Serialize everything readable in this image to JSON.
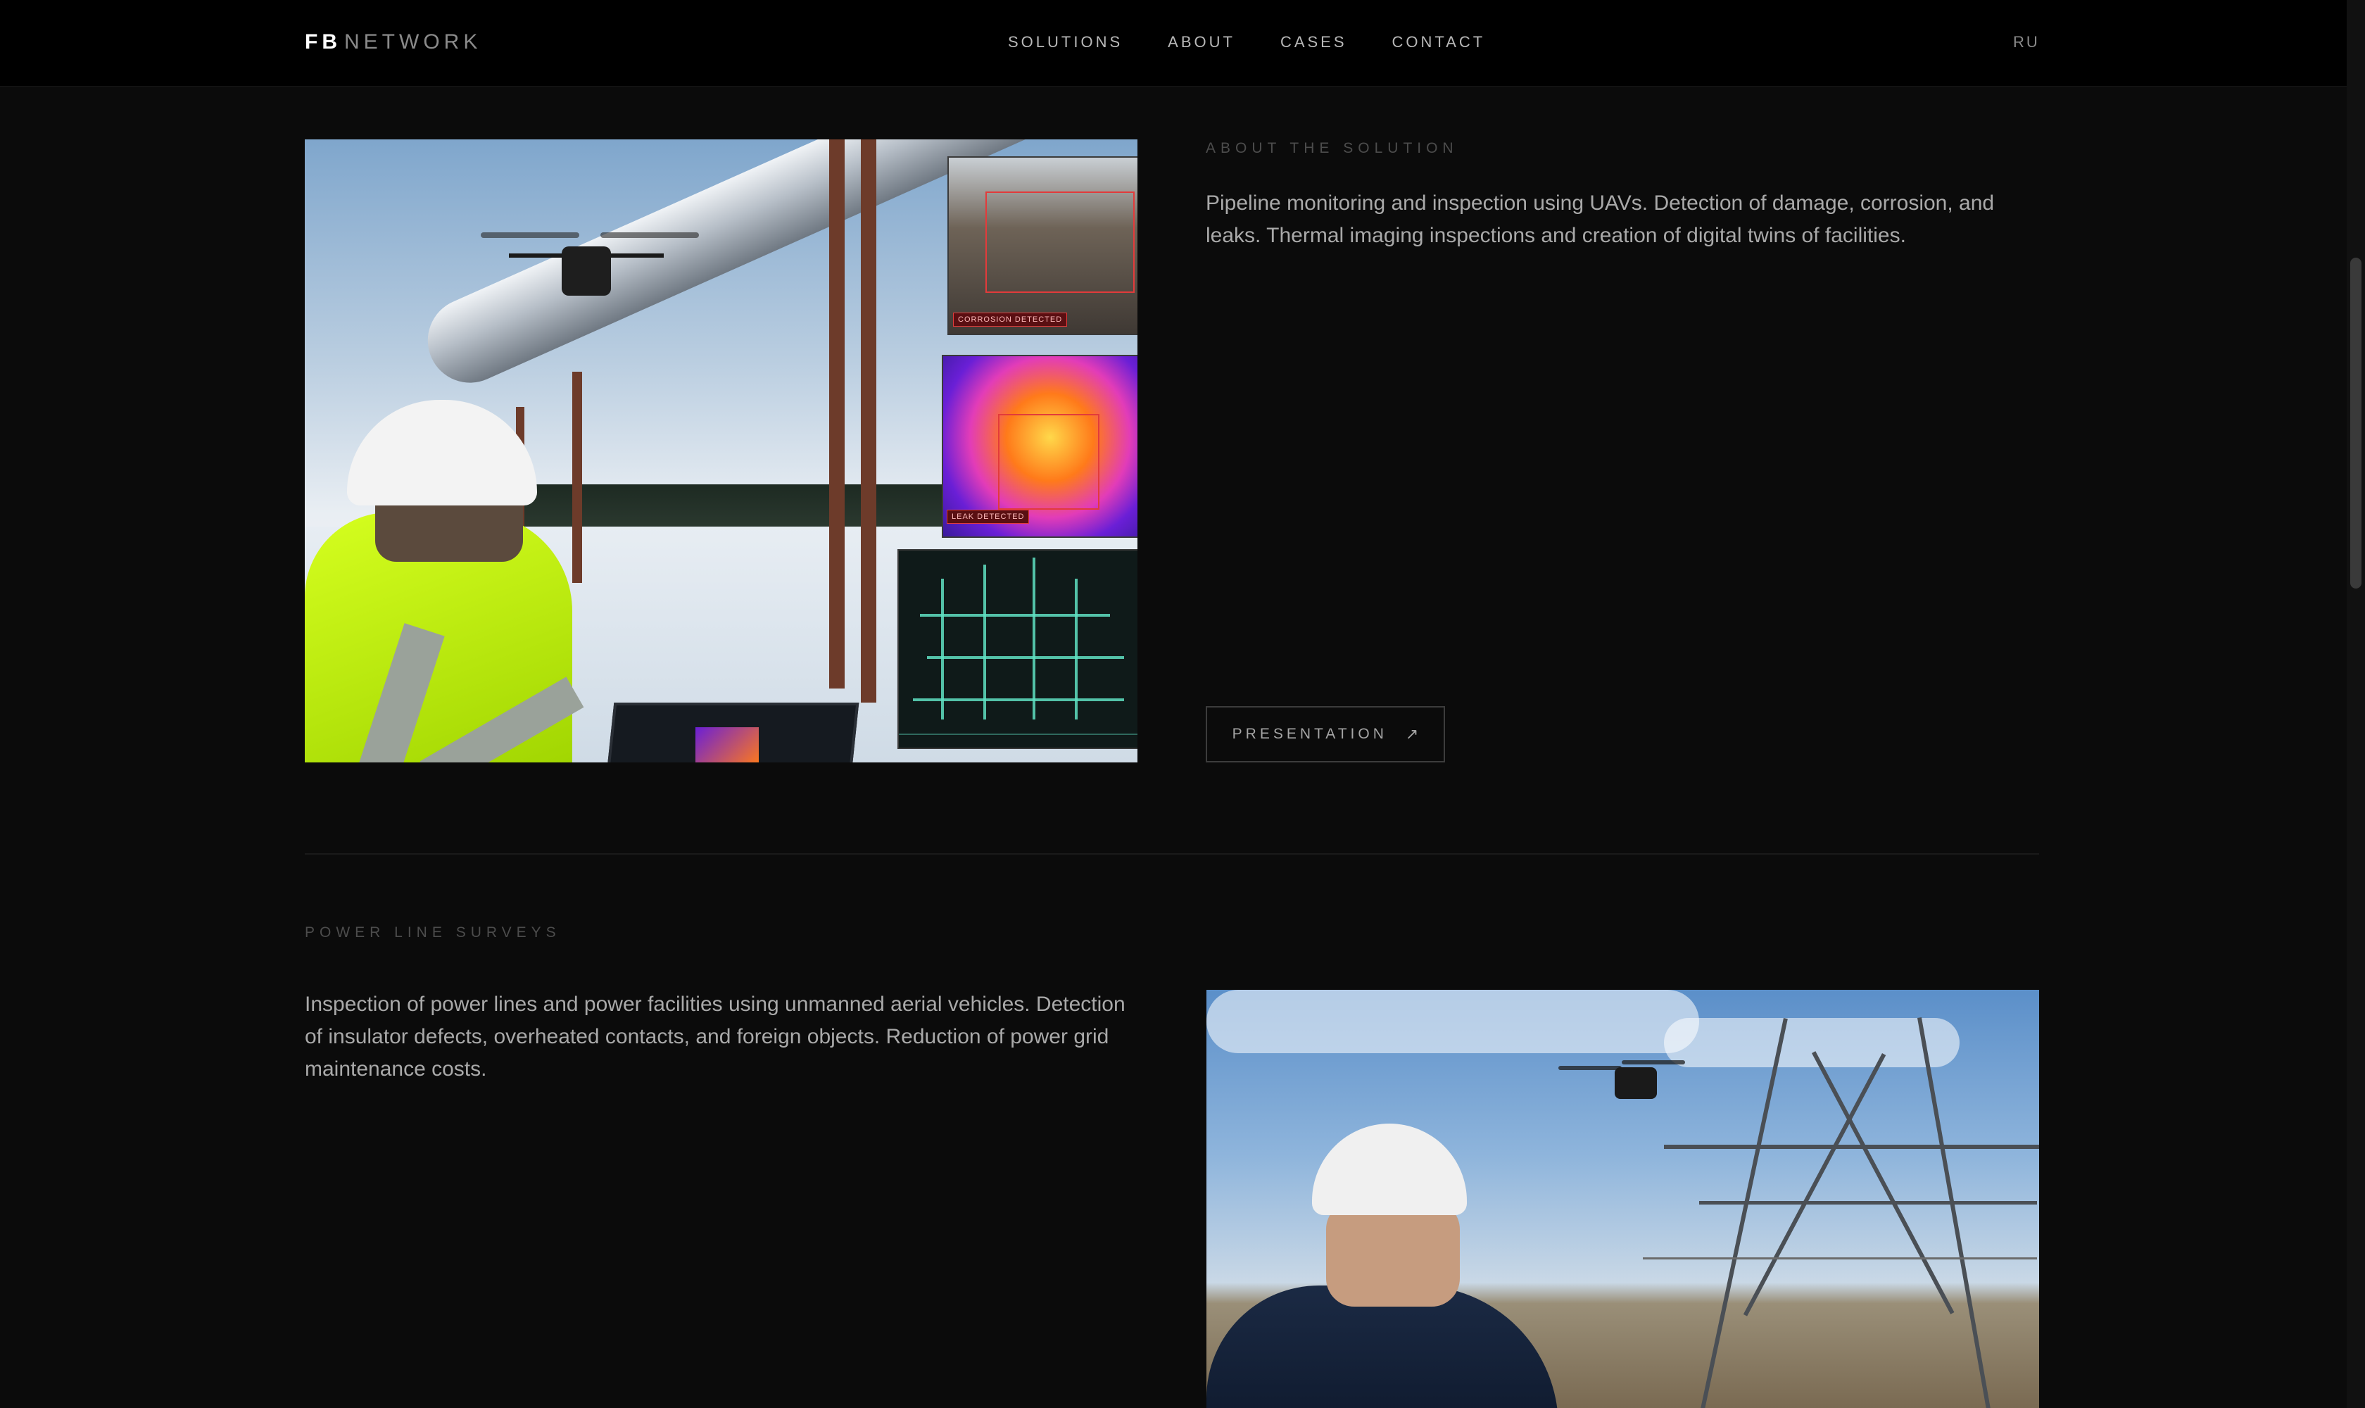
{
  "header": {
    "logo_bold": "FB",
    "logo_light": "NETWORK",
    "nav": [
      {
        "label": "SOLUTIONS"
      },
      {
        "label": "ABOUT"
      },
      {
        "label": "CASES"
      },
      {
        "label": "CONTACT"
      }
    ],
    "language": "RU"
  },
  "section_pipeline": {
    "eyebrow": "ABOUT THE SOLUTION",
    "description": "Pipeline monitoring and inspection using UAVs. Detection of damage, corrosion, and leaks. Thermal imaging inspections and creation of digital twins of facilities.",
    "button_label": "PRESENTATION",
    "button_icon": "arrow-up-right-icon",
    "image": {
      "tag_corrosion": "CORROSION DETECTED",
      "tag_leak": "LEAK DETECTED"
    }
  },
  "section_power": {
    "eyebrow": "POWER LINE SURVEYS",
    "description": "Inspection of power lines and power facilities using unmanned aerial vehicles. Detection of insulator defects, overheated contacts, and foreign objects. Reduction of power grid maintenance costs."
  },
  "colors": {
    "background": "#0b0b0b",
    "header": "#000000",
    "text": "#a9a9a9",
    "accent_red": "#e23b3b"
  }
}
